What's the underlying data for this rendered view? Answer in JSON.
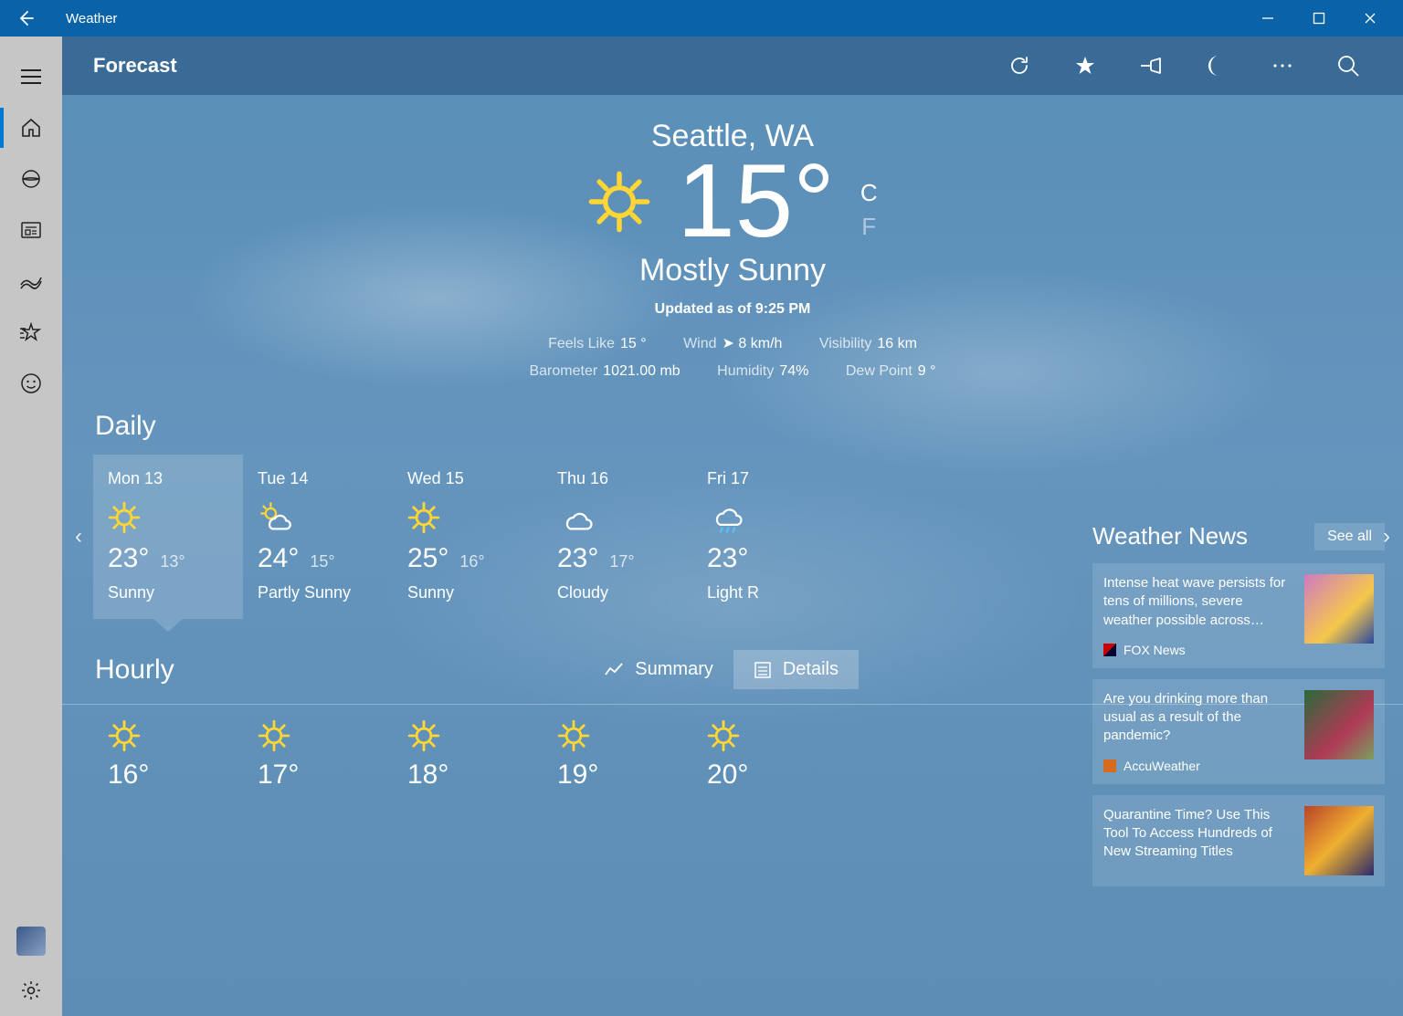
{
  "titlebar": {
    "app_name": "Weather"
  },
  "toolbar": {
    "page_title": "Forecast"
  },
  "hero": {
    "location": "Seattle, WA",
    "temp": "15°",
    "unit_c": "C",
    "unit_f": "F",
    "condition": "Mostly Sunny",
    "updated": "Updated as of 9:25 PM",
    "stats_row1": {
      "feels_lbl": "Feels Like",
      "feels_val": "15 °",
      "wind_lbl": "Wind",
      "wind_val": "8 km/h",
      "vis_lbl": "Visibility",
      "vis_val": "16 km"
    },
    "stats_row2": {
      "baro_lbl": "Barometer",
      "baro_val": "1021.00 mb",
      "hum_lbl": "Humidity",
      "hum_val": "74%",
      "dew_lbl": "Dew Point",
      "dew_val": "9 °"
    }
  },
  "daily": {
    "title": "Daily",
    "days": [
      {
        "date": "Mon 13",
        "hi": "23°",
        "lo": "13°",
        "cond": "Sunny"
      },
      {
        "date": "Tue 14",
        "hi": "24°",
        "lo": "15°",
        "cond": "Partly Sunny"
      },
      {
        "date": "Wed 15",
        "hi": "25°",
        "lo": "16°",
        "cond": "Sunny"
      },
      {
        "date": "Thu 16",
        "hi": "23°",
        "lo": "17°",
        "cond": "Cloudy"
      },
      {
        "date": "Fri 17",
        "hi": "23°",
        "lo": "",
        "cond": "Light R"
      }
    ]
  },
  "hourly": {
    "title": "Hourly",
    "summary_lbl": "Summary",
    "details_lbl": "Details",
    "temps": [
      "16°",
      "17°",
      "18°",
      "19°",
      "20°"
    ]
  },
  "news": {
    "title": "Weather News",
    "seeall": "See all",
    "items": [
      {
        "headline": "Intense heat wave persists for tens of millions, severe weather possible across…",
        "source": "FOX News"
      },
      {
        "headline": "Are you drinking more than usual as a result of the pandemic?",
        "source": "AccuWeather"
      },
      {
        "headline": "Quarantine Time? Use This Tool To Access Hundreds of New Streaming Titles",
        "source": ""
      }
    ]
  }
}
